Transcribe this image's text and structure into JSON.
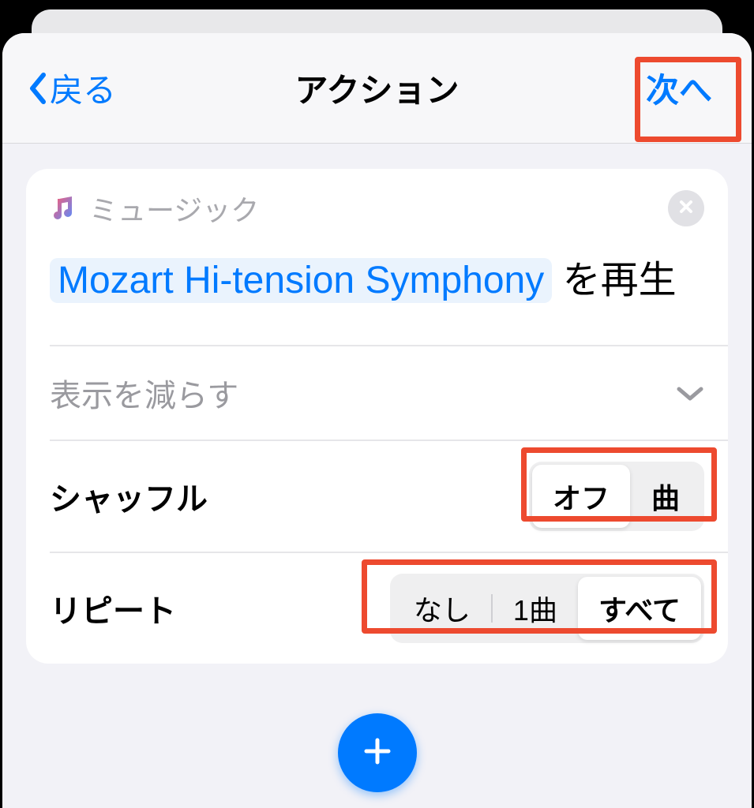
{
  "navbar": {
    "back_label": "戻る",
    "title": "アクション",
    "next_label": "次へ"
  },
  "card": {
    "app_name": "ミュージック",
    "music_token": "Mozart Hi-tension Symphony",
    "play_suffix": " を再生",
    "show_less": "表示を減らす",
    "shuffle": {
      "label": "シャッフル",
      "options": [
        "オフ",
        "曲"
      ],
      "selected": 0
    },
    "repeat": {
      "label": "リピート",
      "options": [
        "なし",
        "1曲",
        "すべて"
      ],
      "selected": 2
    }
  },
  "colors": {
    "accent": "#007aff",
    "highlight": "#ed4a2f"
  }
}
